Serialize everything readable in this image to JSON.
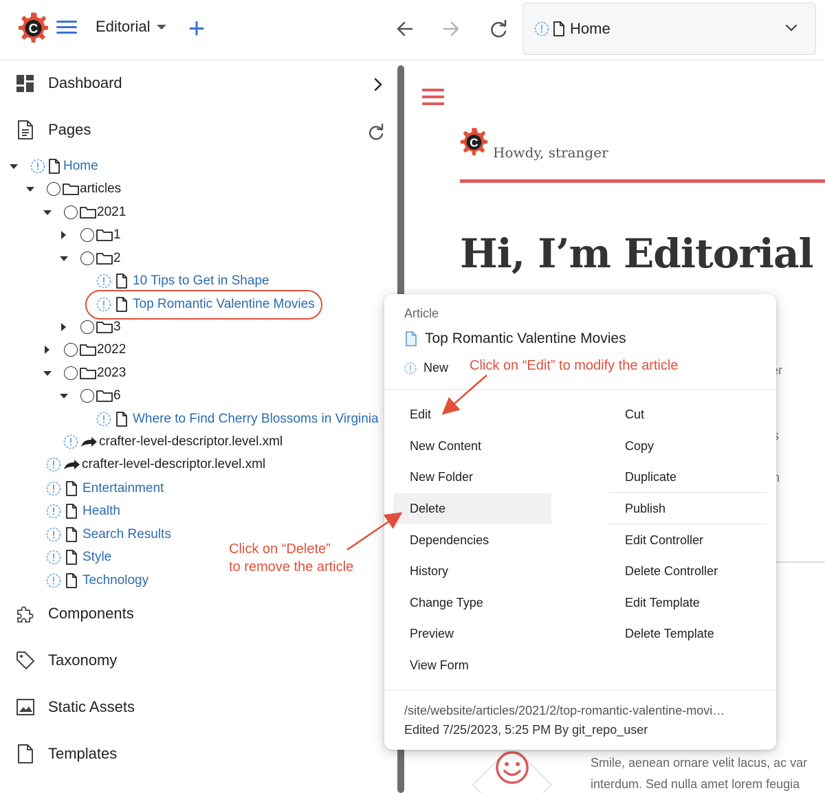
{
  "toolbar": {
    "site_name": "Editorial",
    "address_text": "Home"
  },
  "sidebar": {
    "nav": [
      {
        "label": "Dashboard",
        "icon": "dashboard-icon"
      },
      {
        "label": "Pages",
        "icon": "pages-icon"
      },
      {
        "label": "Components",
        "icon": "components-icon"
      },
      {
        "label": "Taxonomy",
        "icon": "taxonomy-icon"
      },
      {
        "label": "Static Assets",
        "icon": "static-assets-icon"
      },
      {
        "label": "Templates",
        "icon": "templates-icon"
      }
    ],
    "tree": {
      "home": "Home",
      "articles": "articles",
      "y2021": "2021",
      "m1": "1",
      "m2": "2",
      "tips": "10 Tips to Get in Shape",
      "romantic": "Top Romantic Valentine Movies",
      "m3": "3",
      "y2022": "2022",
      "y2023": "2023",
      "m6": "6",
      "cherry": "Where to Find Cherry Blossoms in Virginia",
      "level_descriptor_inner": "crafter-level-descriptor.level.xml",
      "level_descriptor_outer": "crafter-level-descriptor.level.xml",
      "entertainment": "Entertainment",
      "health": "Health",
      "search_results": "Search Results",
      "style": "Style",
      "technology": "Technology"
    }
  },
  "preview": {
    "greeting": "Howdy, stranger",
    "heading": "Hi, I’m Editorial",
    "frag_er": "er",
    "frag_s": "s",
    "frag_n": "n",
    "body_line1": "Smile, aenean ornare velit lacus, ac var",
    "body_line2": "interdum. Sed nulla amet lorem feugia"
  },
  "context_menu": {
    "content_type": "Article",
    "item_title": "Top Romantic Valentine Movies",
    "state": "New",
    "left_items": [
      "Edit",
      "New Content",
      "New Folder",
      "Delete",
      "Dependencies",
      "History",
      "Change Type",
      "Preview",
      "View Form"
    ],
    "right_items": [
      "Cut",
      "Copy",
      "Duplicate",
      "Publish",
      "Edit Controller",
      "Delete Controller",
      "Edit Template",
      "Delete Template"
    ],
    "path": "/site/website/articles/2021/2/top-romantic-valentine-movi…",
    "edited": "Edited 7/25/2023, 5:25 PM By git_repo_user"
  },
  "annotations": {
    "edit_hint": "Click on “Edit” to modify the article",
    "delete_hint_line1": "Click  on “Delete”",
    "delete_hint_line2": "to remove the article"
  },
  "colors": {
    "brand_red": "#e0503a",
    "link_blue": "#2b6cb0",
    "accent_blue": "#3b72d6",
    "annotation_red": "#e0503a"
  }
}
